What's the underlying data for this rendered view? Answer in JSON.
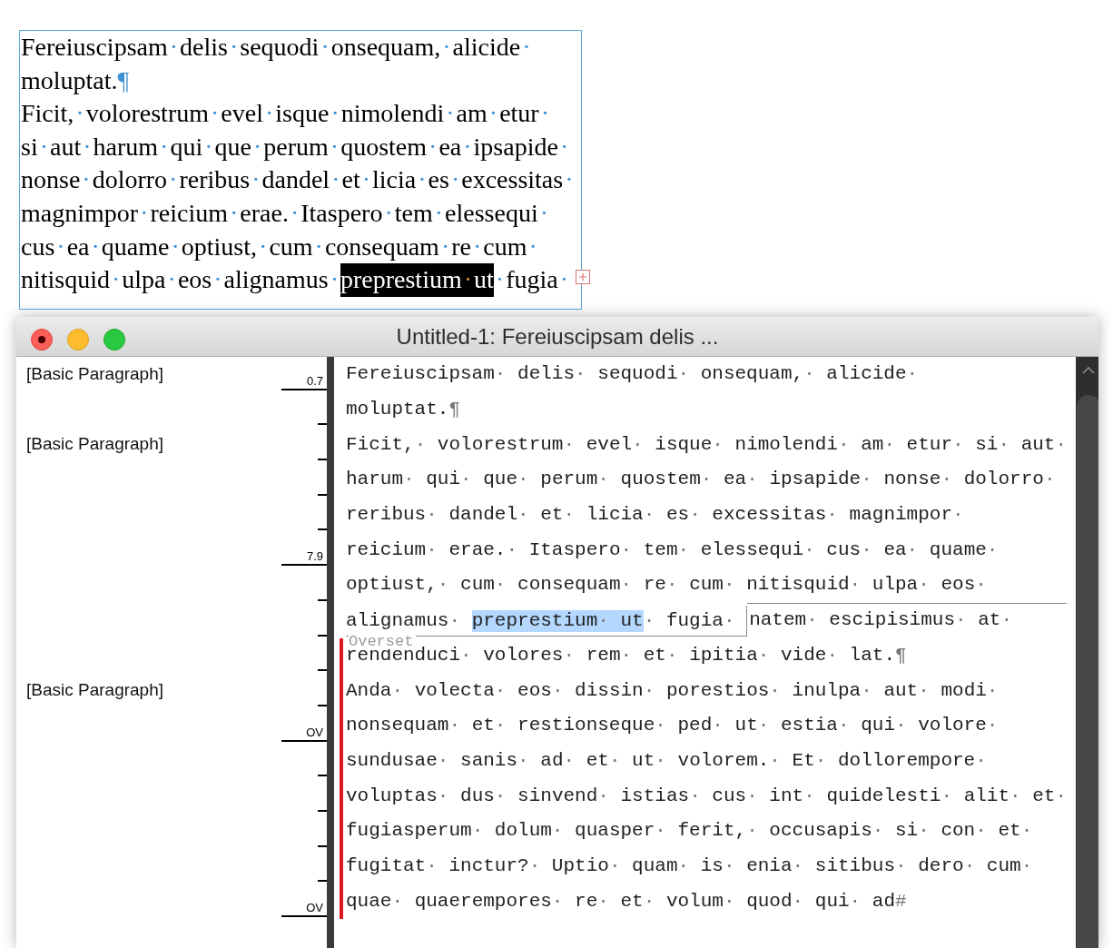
{
  "text_frame": {
    "overset": true,
    "lines": [
      {
        "text": "Fereiuscipsam·delis·sequodi·onsequam,·alicide·"
      },
      {
        "text": "moluptat.¶"
      },
      {
        "text": "Ficit,·volorestrum·evel·isque·nimolendi·am·etur·"
      },
      {
        "text": "si·aut·harum·qui·que·perum·quostem·ea·ipsapide·"
      },
      {
        "text": "nonse·dolorro·reribus·dandel·et·licia·es·excessitas·"
      },
      {
        "text": "magnimpor·reicium·erae.·Itaspero·tem·elessequi·"
      },
      {
        "text": "cus·ea·quame·optiust,·cum·consequam·re·cum·"
      },
      {
        "segments": [
          {
            "text": "nitisquid·ulpa·eos·alignamus·",
            "selected": false
          },
          {
            "text": "preprestium·ut",
            "selected": true
          },
          {
            "text": "·fugia·",
            "selected": false
          }
        ]
      }
    ]
  },
  "story_editor": {
    "title": "Untitled-1: Fereiuscipsam delis ...",
    "overset_label": "Overset",
    "rows": [
      {
        "style": "[Basic Paragraph]",
        "depth": "0.7",
        "overset": false,
        "text": "Fereiuscipsam· delis· sequodi· onsequam,· alicide·"
      },
      {
        "overset": false,
        "text": "moluptat.¶"
      },
      {
        "style": "[Basic Paragraph]",
        "overset": false,
        "text": "Ficit,· volorestrum· evel· isque· nimolendi· am· etur· si· aut·"
      },
      {
        "overset": false,
        "text": "harum· qui· que· perum· quostem· ea· ipsapide· nonse· dolorro·"
      },
      {
        "overset": false,
        "text": "reribus· dandel· et· licia· es· excessitas· magnimpor·"
      },
      {
        "depth": "7.9",
        "overset": false,
        "text": "reicium· erae.· Itaspero· tem· elessequi· cus· ea· quame·"
      },
      {
        "overset": false,
        "text": "optiust,· cum· consequam· re· cum· nitisquid· ulpa· eos·"
      },
      {
        "overset": false,
        "segments": [
          {
            "text": "alignamus· ",
            "selected": false,
            "overset": false
          },
          {
            "text": "preprestium· ut",
            "selected": true,
            "overset": false
          },
          {
            "text": "· fugia· ",
            "selected": false,
            "overset": false
          },
          {
            "text": "natem· escipisimus· at·",
            "selected": false,
            "overset": true
          }
        ]
      },
      {
        "overset": true,
        "text": "rendenduci· volores· rem· et· ipitia· vide· lat.¶"
      },
      {
        "style": "[Basic Paragraph]",
        "overset": true,
        "text": "Anda· volecta· eos· dissin· porestios· inulpa· aut· modi·"
      },
      {
        "depth": "OV",
        "overset": true,
        "text": "nonsequam· et· restionseque· ped· ut· estia· qui· volore·"
      },
      {
        "overset": true,
        "text": "sundusae· sanis· ad· et· ut· volorem.· Et· dollorempore·"
      },
      {
        "overset": true,
        "text": "voluptas· dus· sinvend· istias· cus· int· quidelesti· alit· et·"
      },
      {
        "overset": true,
        "text": "fugiasperum· dolum· quasper· ferit,· occusapis· si· con· et·"
      },
      {
        "overset": true,
        "text": "fugitat· inctur?· Uptio· quam· is· enia· sitibus· dero· cum·"
      },
      {
        "depth": "OV",
        "overset": true,
        "text": "quae· quaerempores· re· et· volum· quod· qui· ad#"
      }
    ]
  }
}
